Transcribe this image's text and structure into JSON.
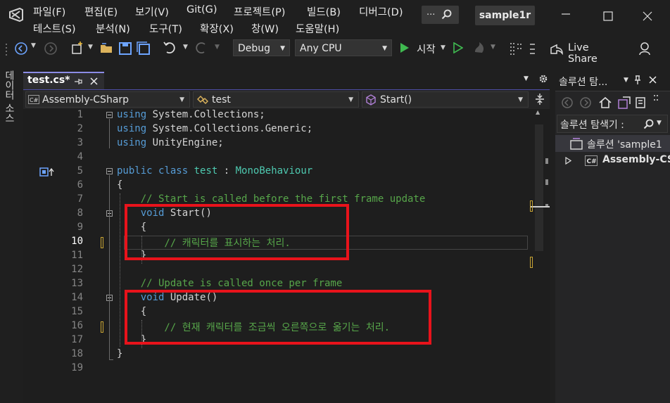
{
  "menu": {
    "row1": [
      "파일(F)",
      "편집(E)",
      "보기(V)",
      "Git(G)",
      "프로젝트(P)",
      "빌드(B)",
      "디버그(D)"
    ],
    "row2": [
      "테스트(S)",
      "분석(N)",
      "도구(T)",
      "확장(X)",
      "창(W)",
      "도움말(H)"
    ],
    "search_placeholder": "...",
    "solution_name": "sample1r"
  },
  "toolbar": {
    "config": "Debug",
    "platform": "Any CPU",
    "start_label": "시작",
    "live_share": "Live Share"
  },
  "left_strip": {
    "label": "데이터 소스"
  },
  "tab": {
    "title": "test.cs*"
  },
  "nav": {
    "project": "Assembly-CSharp",
    "class": "test",
    "member": "Start()"
  },
  "code": {
    "line_numbers": [
      "1",
      "2",
      "3",
      "4",
      "5",
      "6",
      "7",
      "8",
      "9",
      "10",
      "11",
      "12",
      "13",
      "14",
      "15",
      "16",
      "17",
      "18",
      "19"
    ],
    "current_line": 10,
    "lines": [
      [
        {
          "t": "using",
          "c": "kw"
        },
        {
          "t": " System.Collections;",
          "c": "pl"
        }
      ],
      [
        {
          "t": "using",
          "c": "kw"
        },
        {
          "t": " System.Collections.Generic;",
          "c": "pl"
        }
      ],
      [
        {
          "t": "using",
          "c": "kw"
        },
        {
          "t": " UnityEngine;",
          "c": "pl"
        }
      ],
      [],
      [
        {
          "t": "public",
          "c": "kw"
        },
        {
          "t": " ",
          "c": "pl"
        },
        {
          "t": "class",
          "c": "kw"
        },
        {
          "t": " ",
          "c": "pl"
        },
        {
          "t": "test",
          "c": "ty"
        },
        {
          "t": " : ",
          "c": "pl"
        },
        {
          "t": "MonoBehaviour",
          "c": "ty"
        }
      ],
      [
        {
          "t": "{",
          "c": "pl"
        }
      ],
      [
        {
          "t": "    // Start is called before the first frame update",
          "c": "cm"
        }
      ],
      [
        {
          "t": "    ",
          "c": "pl"
        },
        {
          "t": "void",
          "c": "kw"
        },
        {
          "t": " Start()",
          "c": "pl"
        }
      ],
      [
        {
          "t": "    {",
          "c": "pl"
        }
      ],
      [
        {
          "t": "        // 캐릭터를 표시하는 처리.",
          "c": "cm"
        }
      ],
      [
        {
          "t": "    }",
          "c": "pl"
        }
      ],
      [],
      [
        {
          "t": "    // Update is called once per frame",
          "c": "cm"
        }
      ],
      [
        {
          "t": "    ",
          "c": "pl"
        },
        {
          "t": "void",
          "c": "kw"
        },
        {
          "t": " Update()",
          "c": "pl"
        }
      ],
      [
        {
          "t": "    {",
          "c": "pl"
        }
      ],
      [
        {
          "t": "        // 현재 캐릭터를 조금씩 오른쪽으로 옮기는 처리.",
          "c": "cm"
        }
      ],
      [
        {
          "t": "    }",
          "c": "pl"
        }
      ],
      [
        {
          "t": "}",
          "c": "pl"
        }
      ],
      []
    ]
  },
  "solution_explorer": {
    "title": "솔루션 탐...",
    "search_label": "솔루션 탐색기 :",
    "solution_item": "솔루션 'sample1",
    "project_item": "Assembly-CS"
  },
  "colors": {
    "keyword": "#569cd6",
    "type": "#4ec9b0",
    "comment": "#57a64a",
    "highlight_box": "#e8131b"
  }
}
